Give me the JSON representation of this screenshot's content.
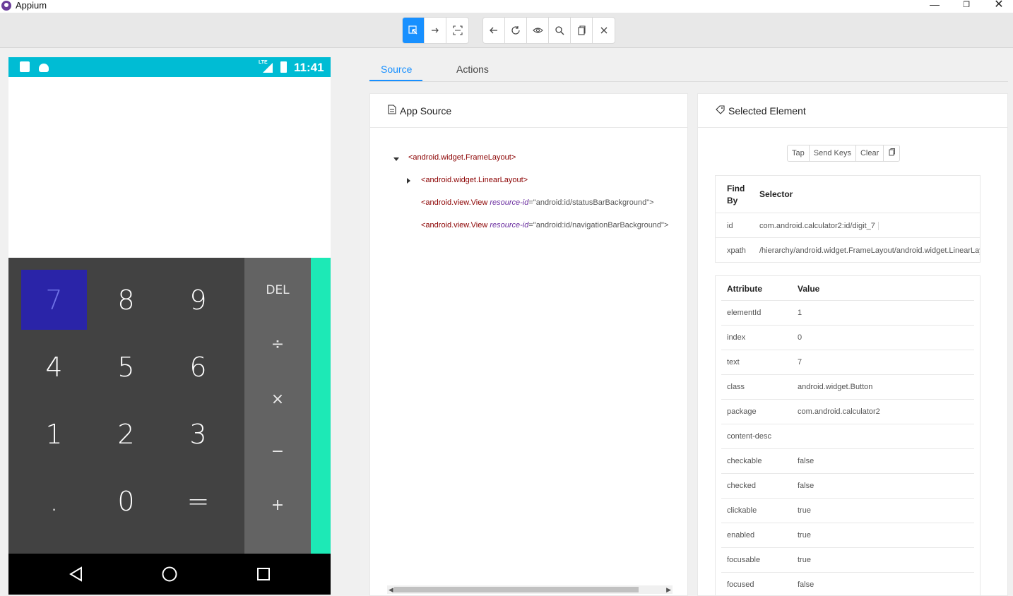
{
  "window": {
    "title": "Appium",
    "min": "—",
    "max": "❐",
    "close": "✕"
  },
  "toolbar": {
    "mode_buttons": [
      "select-element",
      "swipe",
      "tap-by-coordinates"
    ],
    "action_buttons": [
      "back",
      "refresh",
      "show-hide",
      "search",
      "copy-xml",
      "quit"
    ]
  },
  "device": {
    "clock": "11:41",
    "lte": "LTE",
    "status_bar_color": "#00bcd4",
    "keypad": [
      "7",
      "8",
      "9",
      "4",
      "5",
      "6",
      "1",
      "2",
      "3",
      ".",
      "0",
      "="
    ],
    "operators": [
      "DEL",
      "÷",
      "×",
      "−",
      "+"
    ]
  },
  "tabs": {
    "source": "Source",
    "actions": "Actions"
  },
  "source_panel": {
    "title": "App Source",
    "tree": {
      "root": "<android.widget.FrameLayout>",
      "child1": "<android.widget.LinearLayout>",
      "child2_tag": "<android.view.View ",
      "child2_attr": "resource-id",
      "child2_val": "=\"android:id/statusBarBackground\">",
      "child3_tag": "<android.view.View ",
      "child3_attr": "resource-id",
      "child3_val": "=\"android:id/navigationBarBackground\">"
    }
  },
  "selected_panel": {
    "title": "Selected Element",
    "actions": {
      "tap": "Tap",
      "send_keys": "Send Keys",
      "clear": "Clear"
    },
    "selector_header": {
      "find_by": "Find By",
      "selector": "Selector"
    },
    "selectors": [
      {
        "find_by": "id",
        "selector": "com.android.calculator2:id/digit_7"
      },
      {
        "find_by": "xpath",
        "selector": "/hierarchy/android.widget.FrameLayout/android.widget.LinearLayout"
      }
    ],
    "attr_header": {
      "attribute": "Attribute",
      "value": "Value"
    },
    "attributes": [
      {
        "name": "elementId",
        "value": "1"
      },
      {
        "name": "index",
        "value": "0"
      },
      {
        "name": "text",
        "value": "7"
      },
      {
        "name": "class",
        "value": "android.widget.Button"
      },
      {
        "name": "package",
        "value": "com.android.calculator2"
      },
      {
        "name": "content-desc",
        "value": ""
      },
      {
        "name": "checkable",
        "value": "false"
      },
      {
        "name": "checked",
        "value": "false"
      },
      {
        "name": "clickable",
        "value": "true"
      },
      {
        "name": "enabled",
        "value": "true"
      },
      {
        "name": "focusable",
        "value": "true"
      },
      {
        "name": "focused",
        "value": "false"
      }
    ]
  },
  "colors": {
    "accent": "#1890ff",
    "selected_key": "#2a24a8",
    "advanced_pad": "#1de9b6"
  }
}
